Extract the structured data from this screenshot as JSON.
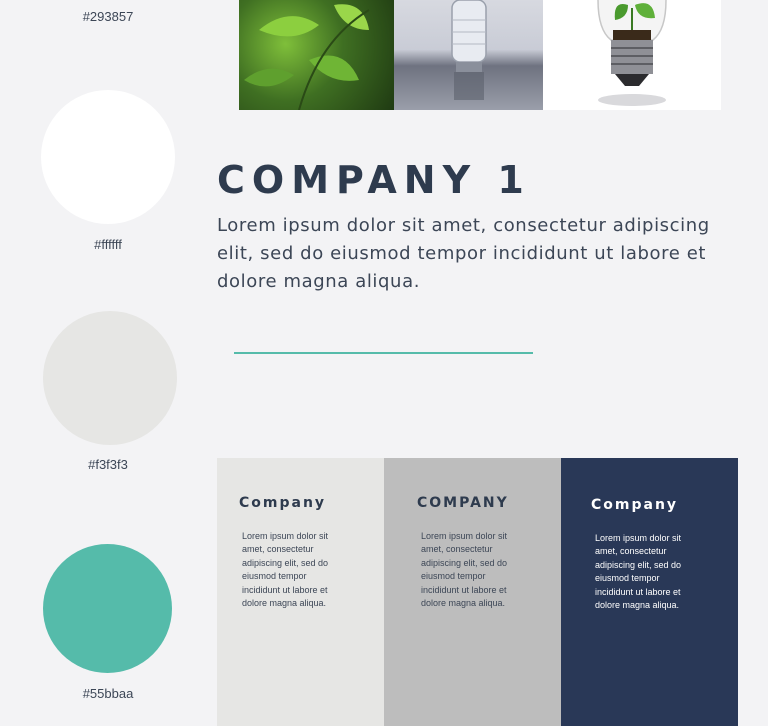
{
  "palette": {
    "swatches": [
      {
        "hex_label": "#293857",
        "color": "#293857"
      },
      {
        "hex_label": "#ffffff",
        "color": "#ffffff"
      },
      {
        "hex_label": "#f3f3f3",
        "color": "#e6e6e4"
      },
      {
        "hex_label": "#55bbaa",
        "color": "#55bbaa"
      }
    ]
  },
  "photos": [
    {
      "icon": "leaves-photo",
      "color": "#4f7f2a"
    },
    {
      "icon": "water-bottle-photo",
      "color": "#b9bcc6"
    },
    {
      "icon": "plant-lightbulb-photo",
      "color": "#ffffff"
    }
  ],
  "hero": {
    "title": "COMPANY 1",
    "description": "Lorem ipsum dolor sit amet, consectetur adipiscing elit, sed do eiusmod tempor incididunt ut labore et dolore magna aliqua.",
    "divider_color": "#55bbaa"
  },
  "cards": [
    {
      "title": "Company",
      "text": "Lorem ipsum dolor sit amet, consectetur adipiscing elit, sed do eiusmod tempor incididunt ut labore et dolore magna aliqua.",
      "background": "#e6e6e4",
      "title_color": "#2e3b4e",
      "text_color": "#3c4656"
    },
    {
      "title": "COMPANY",
      "text": "Lorem ipsum dolor sit amet, consectetur adipiscing elit, sed do eiusmod tempor incididunt ut labore et dolore magna aliqua.",
      "background": "#bdbdbd",
      "title_color": "#2e3b4e",
      "text_color": "#3c4656"
    },
    {
      "title": "Company",
      "text": "Lorem ipsum dolor sit amet, consectetur adipiscing elit, sed do eiusmod tempor incididunt ut labore et dolore magna aliqua.",
      "background": "#293857",
      "title_color": "#ffffff",
      "text_color": "#ffffff"
    }
  ]
}
